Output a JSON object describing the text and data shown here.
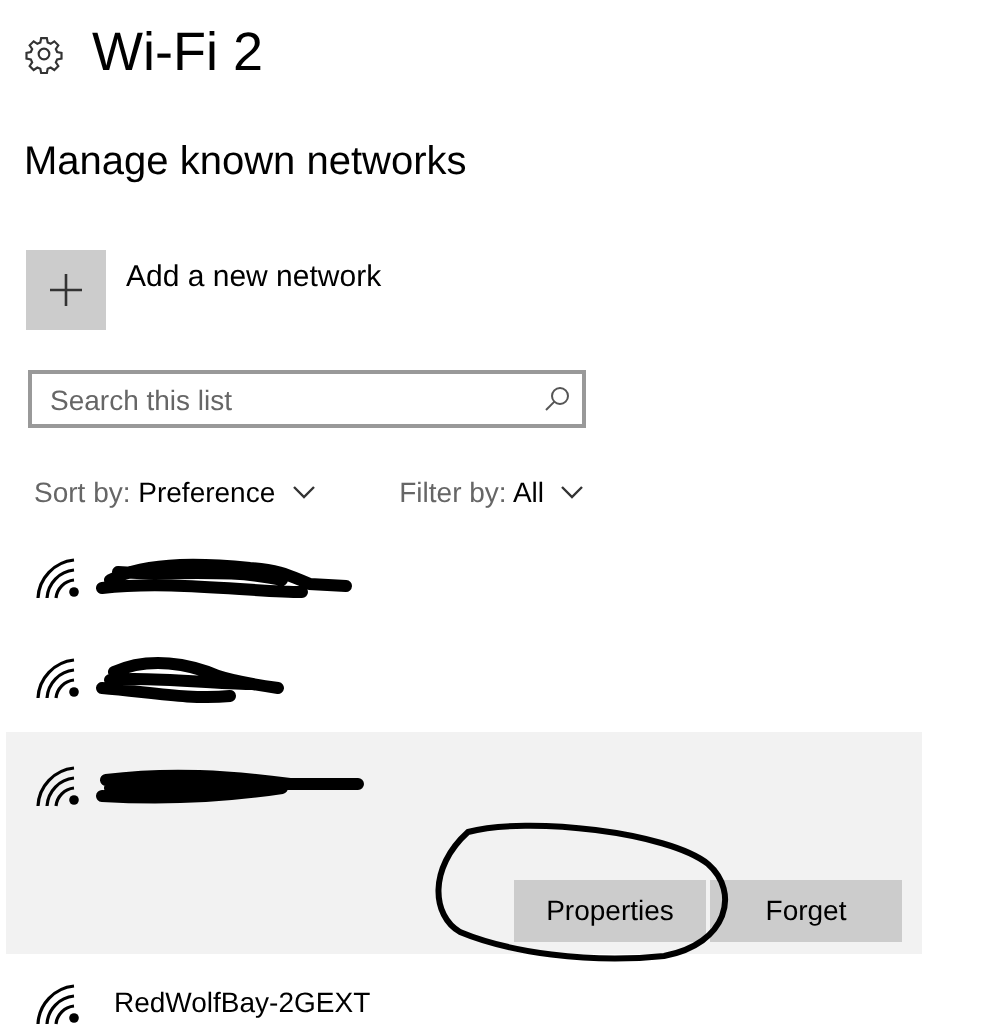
{
  "title": "Wi-Fi 2",
  "heading": "Manage known networks",
  "add_network": {
    "label": "Add a new network"
  },
  "search": {
    "placeholder": "Search this list"
  },
  "sort": {
    "label": "Sort by:",
    "value": "Preference"
  },
  "filter": {
    "label": "Filter by:",
    "value": "All"
  },
  "networks": [
    {
      "name_redacted": true,
      "selected": false
    },
    {
      "name_redacted": true,
      "selected": false
    },
    {
      "name_redacted": true,
      "selected": true,
      "actions": [
        "Properties",
        "Forget"
      ]
    },
    {
      "name": "RedWolfBay-2GEXT",
      "selected": false
    }
  ]
}
